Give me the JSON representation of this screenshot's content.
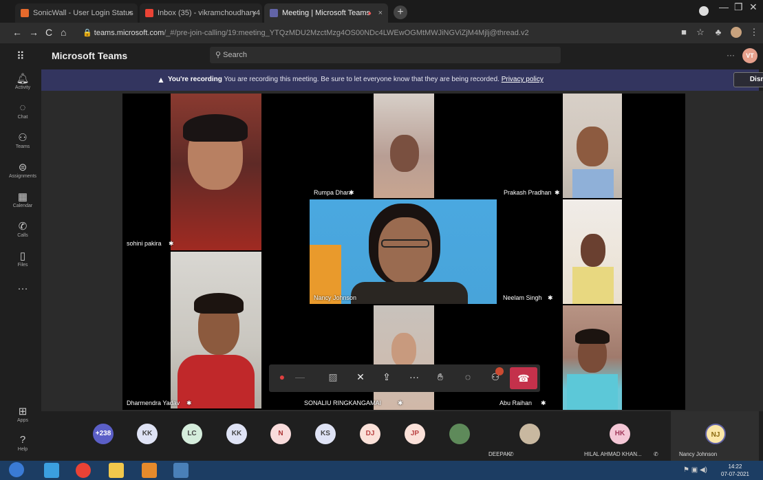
{
  "browser": {
    "tabs": [
      {
        "title": "SonicWall - User Login Status",
        "close": "×",
        "active": false
      },
      {
        "title": "Inbox (35) - vikramchoudhary4",
        "close": "×",
        "active": false
      },
      {
        "title": "Meeting | Microsoft Teams",
        "close": "×",
        "active": true
      }
    ],
    "new_tab": "+",
    "url_host": "teams.microsoft.com",
    "url_path": "/_#/pre-join-calling/19:meeting_YTQzMDU2MzctMzg4OS00NDc4LWEwOGMtMWJiNGViZjM4Mjlj@thread.v2",
    "window_controls": [
      "—",
      "❐",
      "✕"
    ]
  },
  "teams": {
    "app_name": "Microsoft Teams",
    "search_placeholder": "Search",
    "more": "···",
    "user_initials": "VT"
  },
  "rail": [
    {
      "label": "Activity",
      "icon": "bell-icon"
    },
    {
      "label": "Chat",
      "icon": "chat-icon"
    },
    {
      "label": "Teams",
      "icon": "teams-icon"
    },
    {
      "label": "Assignments",
      "icon": "assignments-icon"
    },
    {
      "label": "Calendar",
      "icon": "calendar-icon"
    },
    {
      "label": "Calls",
      "icon": "calls-icon"
    },
    {
      "label": "Files",
      "icon": "files-icon"
    },
    {
      "label": "···",
      "icon": "more-icon"
    },
    {
      "label": "Apps",
      "icon": "apps-icon"
    },
    {
      "label": "Help",
      "icon": "help-icon"
    }
  ],
  "banner": {
    "bold": "You're recording",
    "message": "You are recording this meeting. Be sure to let everyone know that they are being recorded.",
    "link": "Privacy policy",
    "dismiss": "Dismiss"
  },
  "participants": [
    {
      "name": "sohini pakira"
    },
    {
      "name": "Rumpa Dhara"
    },
    {
      "name": "Prakash Pradhan"
    },
    {
      "name": "Nancy Johnson"
    },
    {
      "name": "Neelam Singh"
    },
    {
      "name": "Dharmendra Yadav"
    },
    {
      "name": "SONALIU RINGKANGAMAI"
    },
    {
      "name": "Abu Raihan"
    }
  ],
  "strip": {
    "overflow": "+238",
    "avatars": [
      "KK",
      "LC",
      "KK",
      "N",
      "KS",
      "DJ",
      "JP"
    ],
    "names": [
      "DEEPAK",
      "HILAL AHMAD KHAN...",
      "Nancy Johnson"
    ],
    "initials": [
      "HK",
      "NJ"
    ]
  },
  "clock": {
    "time": "14:22",
    "date": "07-07-2021"
  },
  "colors": {
    "banner": "#33355f",
    "hangup": "#c4314b",
    "accent": "#6264a7"
  }
}
